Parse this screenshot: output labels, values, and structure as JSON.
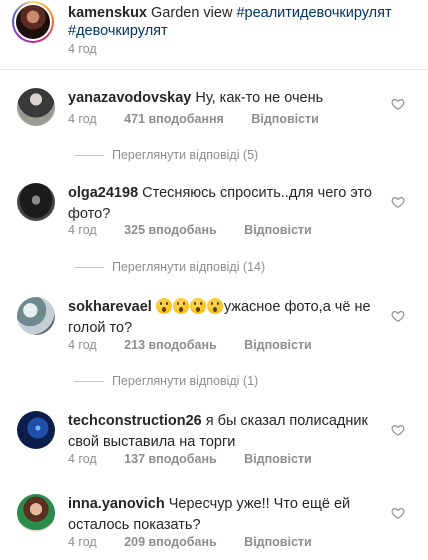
{
  "caption": {
    "username": "kamenskux",
    "text": "Garden view",
    "hashtags": [
      "#реалитидевочкирулят",
      "#девочкирулят"
    ],
    "time": "4 год"
  },
  "labels": {
    "reply": "Відповісти"
  },
  "comments": [
    {
      "username": "yanazavodovskay",
      "text": "Ну, как-то не очень",
      "time": "4 год",
      "likes": "471 вподобання",
      "view_replies": "Переглянути відповіді (5)"
    },
    {
      "username": "olga24198",
      "text": "Стесняюсь спросить..для чего это фото?",
      "time": "4 год",
      "likes": "325 вподобань",
      "view_replies": "Переглянути відповіді (14)"
    },
    {
      "username": "sokharevael",
      "emoji": "😮😮😮😮",
      "text": "ужасное фото,а чё не голой то?",
      "time": "4 год",
      "likes": "213 вподобань",
      "view_replies": "Переглянути відповіді (1)"
    },
    {
      "username": "techconstruction26",
      "text": "я бы сказал полисадник свой выставила на торги",
      "time": "4 год",
      "likes": "137 вподобань"
    },
    {
      "username": "inna.yanovich",
      "text": "Чересчур уже!! Что ещё ей осталось показать?",
      "time": "4 год",
      "likes": "209 вподобань"
    }
  ],
  "icons": {
    "like": "heart-outline-icon"
  }
}
